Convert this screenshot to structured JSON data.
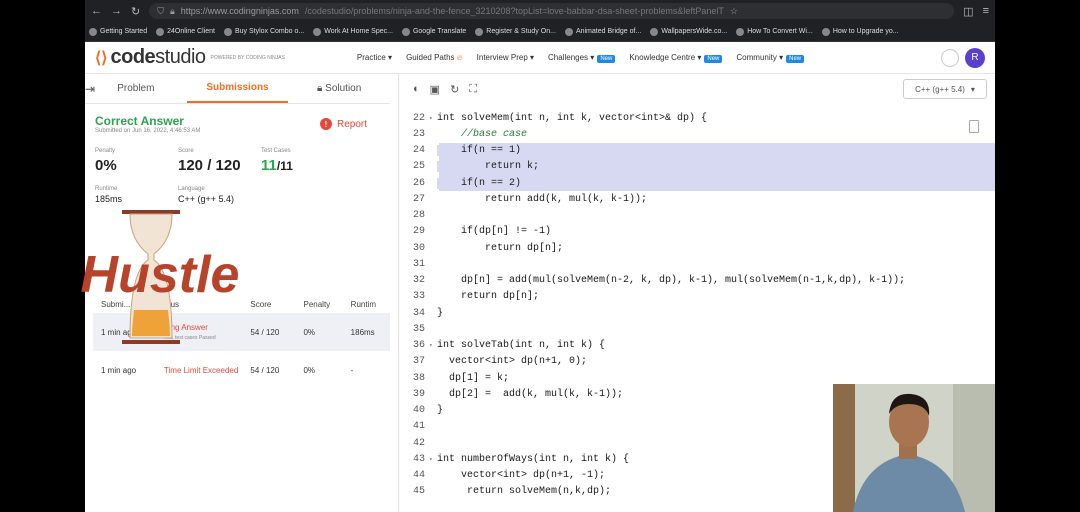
{
  "browser": {
    "url_host": "https://www.codingninjas.com",
    "url_path": "/codestudio/problems/ninja-and-the-fence_3210208?topList=love-babbar-dsa-sheet-problems&leftPanelT"
  },
  "bookmarks": [
    "Getting Started",
    "24Online Client",
    "Buy Stylox Combo o...",
    "Work At Home Spec...",
    "Google Translate",
    "Register & Study On...",
    "Animated Bridge of...",
    "WallpapersWide.co...",
    "How To Convert Wi...",
    "How to Upgrade yo..."
  ],
  "site": {
    "logo_code": "code",
    "logo_studio": "studio",
    "logo_sub": "POWERED BY CODING NINJAS",
    "nav": [
      "Practice ▾",
      "Guided Paths",
      "Interview Prep ▾",
      "Challenges",
      "Knowledge Centre ▾",
      "Community ▾"
    ],
    "new_badge": "New",
    "avatar": "R"
  },
  "tabs": {
    "problem": "Problem",
    "submissions": "Submissions",
    "solution": "Solution"
  },
  "result": {
    "status": "Correct Answer",
    "submitted": "Submitted on Jun 16, 2022, 4:46:53 AM",
    "report": "Report",
    "penalty_label": "Penalty",
    "penalty": "0%",
    "score_label": "Score",
    "score": "120 / 120",
    "tc_label": "Test Cases",
    "tc_pass": "11",
    "tc_total": "/11",
    "runtime_label": "Runtime",
    "runtime": "185ms",
    "lang_label": "Language",
    "lang": "C++ (g++ 5.4)"
  },
  "table": {
    "headers": [
      "Submi...",
      "...us",
      "Score",
      "Penalty",
      "Runtim"
    ],
    "rows": [
      {
        "time": "1 min ag...",
        "status": "...ng Answer",
        "sub": "...ut, test cases Passed",
        "score": "54 / 120",
        "penalty": "0%",
        "runtime": "186ms"
      },
      {
        "time": "1 min ago",
        "status": "Time Limit Exceeded",
        "sub": "",
        "score": "54 / 120",
        "penalty": "0%",
        "runtime": "-"
      }
    ]
  },
  "editor": {
    "language": "C++ (g++ 5.4)",
    "lines": [
      {
        "n": "22",
        "t": "int solveMem(int n, int k, vector<int>& dp) {",
        "fold": true
      },
      {
        "n": "23",
        "t": "    //base case",
        "c": true
      },
      {
        "n": "24",
        "t": "    if(n == 1)",
        "sel": true
      },
      {
        "n": "25",
        "t": "        return k;",
        "sel": true
      },
      {
        "n": "26",
        "t": "    if(n == 2)",
        "sel": true
      },
      {
        "n": "27",
        "t": "        return add(k, mul(k, k-1));"
      },
      {
        "n": "28",
        "t": ""
      },
      {
        "n": "29",
        "t": "    if(dp[n] != -1)"
      },
      {
        "n": "30",
        "t": "        return dp[n];"
      },
      {
        "n": "31",
        "t": ""
      },
      {
        "n": "32",
        "t": "    dp[n] = add(mul(solveMem(n-2, k, dp), k-1), mul(solveMem(n-1,k,dp), k-1));"
      },
      {
        "n": "33",
        "t": "    return dp[n];"
      },
      {
        "n": "34",
        "t": "}"
      },
      {
        "n": "35",
        "t": ""
      },
      {
        "n": "36",
        "t": "int solveTab(int n, int k) {",
        "fold": true
      },
      {
        "n": "37",
        "t": "  vector<int> dp(n+1, 0);"
      },
      {
        "n": "38",
        "t": "  dp[1] = k;"
      },
      {
        "n": "39",
        "t": "  dp[2] =  add(k, mul(k, k-1));"
      },
      {
        "n": "40",
        "t": "}"
      },
      {
        "n": "41",
        "t": ""
      },
      {
        "n": "42",
        "t": ""
      },
      {
        "n": "43",
        "t": "int numberOfWays(int n, int k) {",
        "fold": true
      },
      {
        "n": "44",
        "t": "    vector<int> dp(n+1, -1);"
      },
      {
        "n": "45",
        "t": "     return solveMem(n,k,dp);"
      }
    ]
  },
  "watermark": {
    "text": "Hustle"
  }
}
